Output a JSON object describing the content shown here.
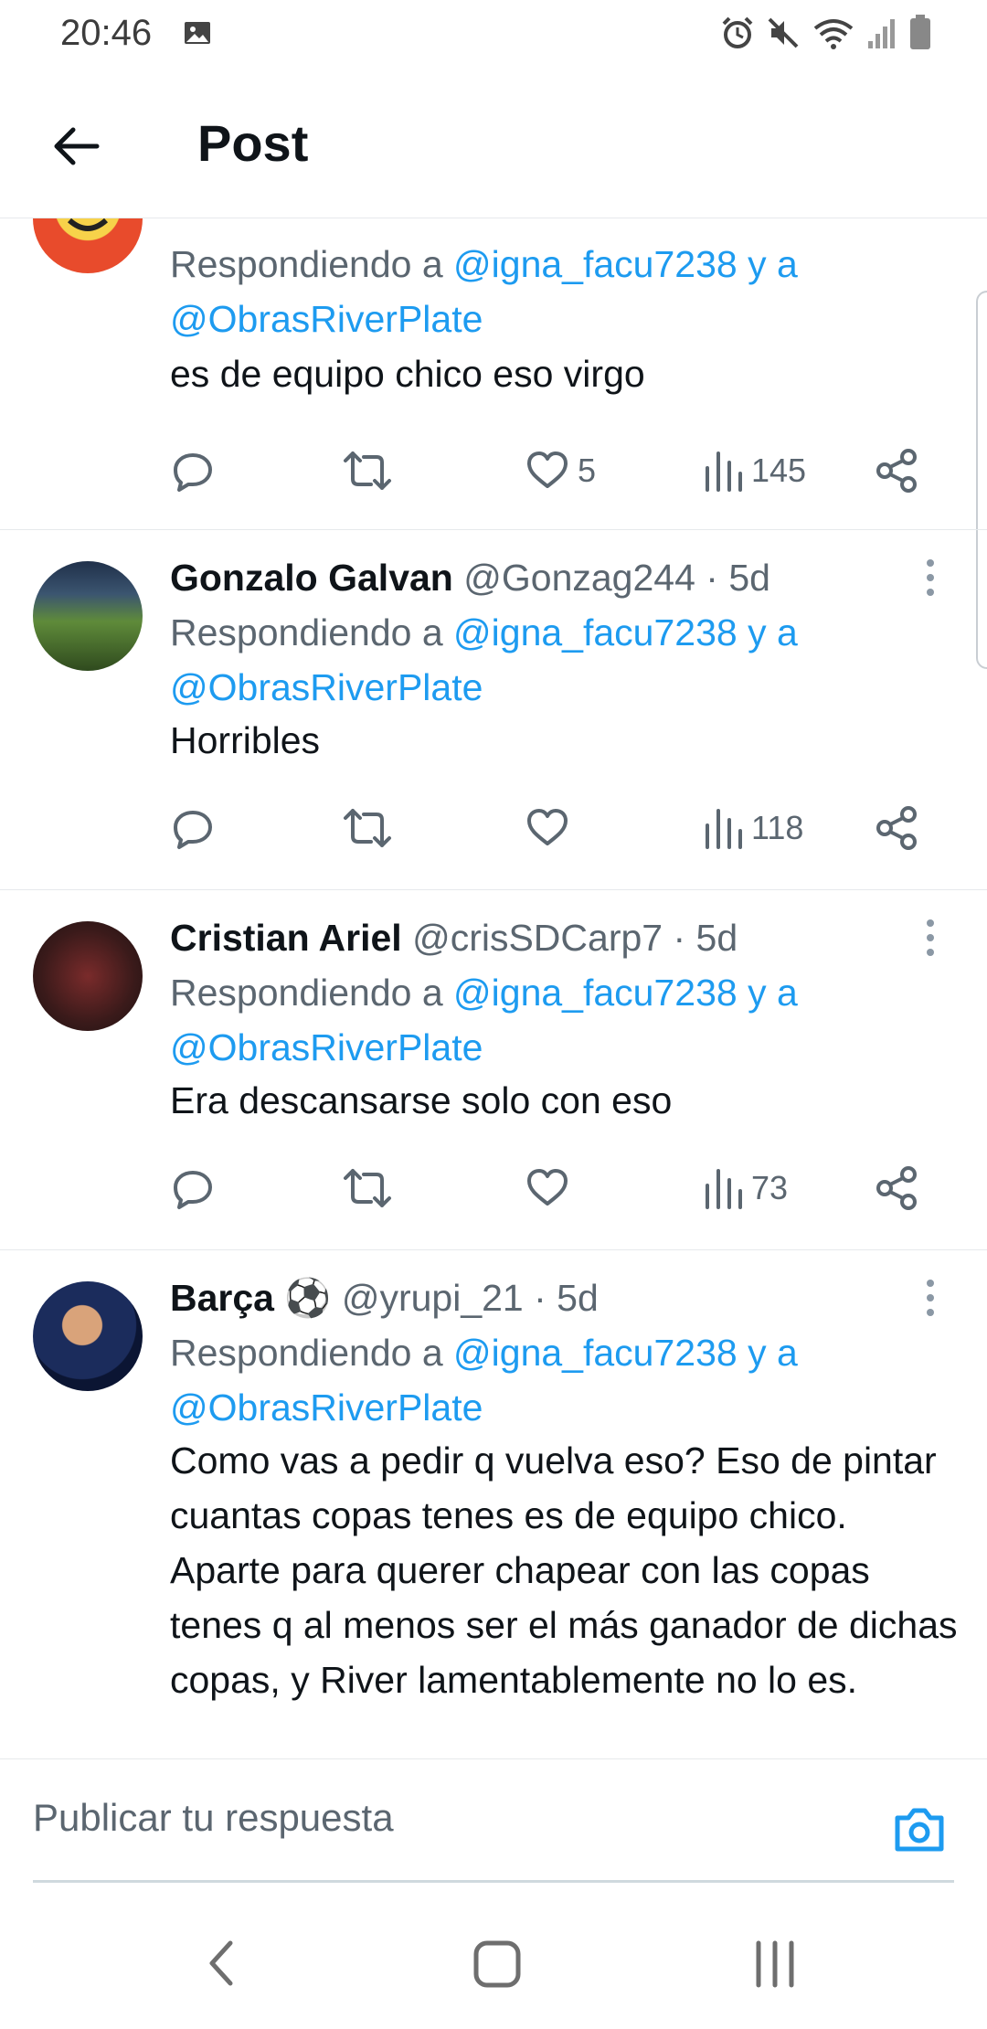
{
  "status_bar": {
    "time": "20:46"
  },
  "header": {
    "title": "Post"
  },
  "tweets": [
    {
      "name": "",
      "handle": "",
      "reply_prefix": "Respondiendo a",
      "reply_user1": "@igna_facu7238",
      "reply_and": "y a",
      "reply_user2": "@ObrasRiverPlate",
      "text": "es de equipo chico eso virgo",
      "likes": "5",
      "views": "145"
    },
    {
      "name": "Gonzalo Galvan",
      "handle": "@Gonzag244 · 5d",
      "reply_prefix": "Respondiendo a",
      "reply_user1": "@igna_facu7238",
      "reply_and": "y a",
      "reply_user2": "@ObrasRiverPlate",
      "text": "Horribles",
      "likes": "",
      "views": "118"
    },
    {
      "name": "Cristian Ariel",
      "handle": "@crisSDCarp7 · 5d",
      "reply_prefix": "Respondiendo a",
      "reply_user1": "@igna_facu7238",
      "reply_and": "y a",
      "reply_user2": "@ObrasRiverPlate",
      "text": "Era descansarse solo con eso",
      "likes": "",
      "views": "73"
    },
    {
      "name": "Barça ⚽",
      "handle": "@yrupi_21 · 5d",
      "reply_prefix": "Respondiendo a",
      "reply_user1": "@igna_facu7238",
      "reply_and": "y a",
      "reply_user2": "@ObrasRiverPlate",
      "text": "Como vas a pedir q vuelva eso?  Eso de pintar cuantas copas tenes es de equipo chico. Aparte para querer chapear con las copas tenes q al menos ser el más ganador de dichas copas, y River lamentablemente no lo es.",
      "likes": "",
      "views": ""
    }
  ],
  "composer": {
    "placeholder": "Publicar tu respuesta"
  },
  "colors": {
    "accent": "#1d9bf0",
    "muted": "#5b6670",
    "text": "#0f1419"
  },
  "icons": [
    "back-arrow-icon",
    "reply-icon",
    "retweet-icon",
    "like-icon",
    "views-icon",
    "share-icon",
    "more-icon",
    "camera-icon"
  ]
}
